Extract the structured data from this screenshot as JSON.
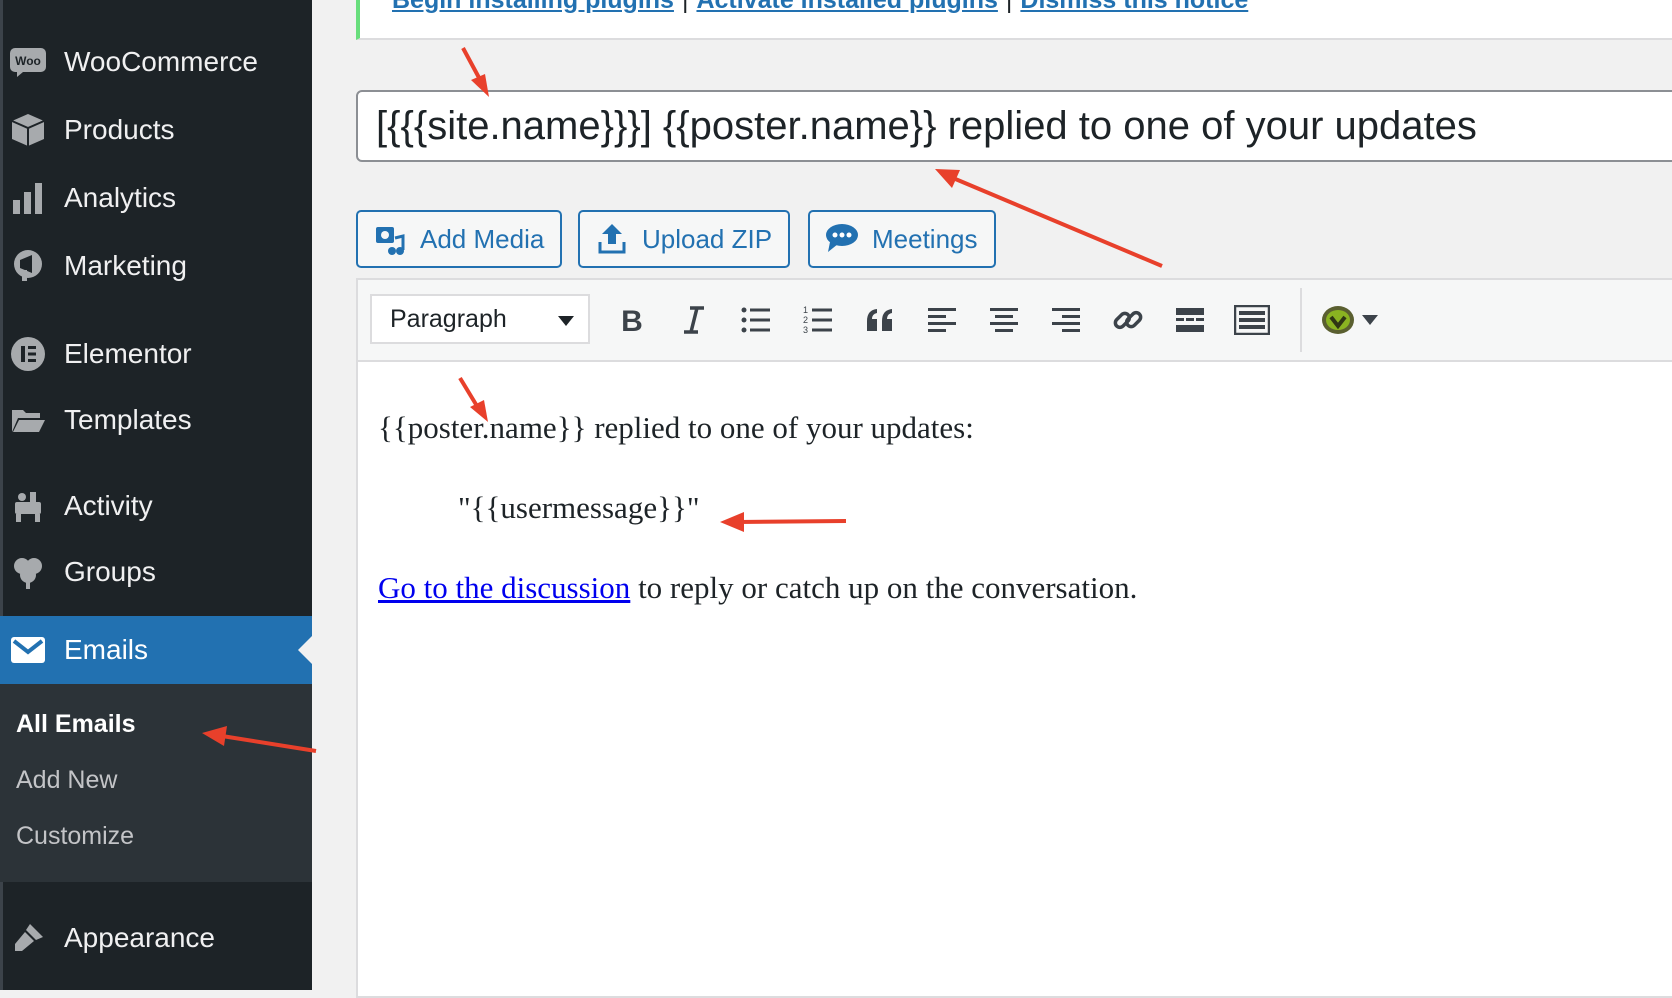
{
  "sidebar": {
    "items": [
      {
        "label": "WooCommerce",
        "icon": "woo-icon"
      },
      {
        "label": "Products",
        "icon": "box-icon"
      },
      {
        "label": "Analytics",
        "icon": "bar-chart-icon"
      },
      {
        "label": "Marketing",
        "icon": "megaphone-icon"
      },
      {
        "label": "Elementor",
        "icon": "elementor-icon"
      },
      {
        "label": "Templates",
        "icon": "folder-icon"
      },
      {
        "label": "Activity",
        "icon": "activity-icon"
      },
      {
        "label": "Groups",
        "icon": "groups-icon"
      },
      {
        "label": "Emails",
        "icon": "envelope-icon"
      },
      {
        "label": "Appearance",
        "icon": "paintbrush-icon"
      }
    ],
    "submenu": [
      "All Emails",
      "Add New",
      "Customize"
    ],
    "woo_badge": "Woo"
  },
  "notice": {
    "link1": "Begin installing plugins",
    "link2": "Activate installed plugins",
    "link3": "Dismiss this notice",
    "separator": "|"
  },
  "title": {
    "value": "[{{{site.name}}}] {{poster.name}} replied to one of your updates"
  },
  "media_buttons": {
    "add_media": "Add Media",
    "upload_zip": "Upload ZIP",
    "meetings": "Meetings"
  },
  "toolbar": {
    "format": "Paragraph"
  },
  "content": {
    "line1": "{{poster.name}} replied to one of your updates:",
    "quote": "\"{{usermessage}}\"",
    "link": "Go to the discussion",
    "line3_rest": " to reply or catch up on the conversation."
  },
  "colors": {
    "sidebar_bg": "#1d2327",
    "current_menu": "#2271b1",
    "arrow": "#e8402b"
  }
}
